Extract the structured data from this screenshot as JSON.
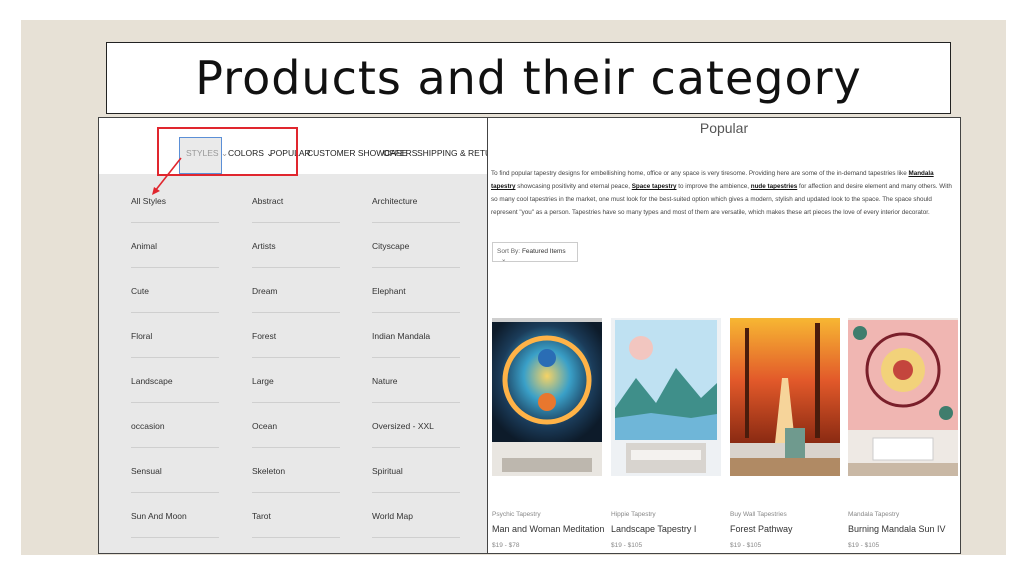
{
  "slide": {
    "title": "Products and their category"
  },
  "nav": {
    "items": [
      {
        "label": "STYLES",
        "chevron": "⌄"
      },
      {
        "label": "COLORS",
        "chevron": "⌄"
      },
      {
        "label": "POPULAR"
      },
      {
        "label": "CUSTOMER SHOWCASE"
      },
      {
        "label": "OFFERS"
      },
      {
        "label": "SHIPPING & RETURNS"
      }
    ]
  },
  "styles_menu": {
    "columns": [
      [
        "All Styles",
        "Animal",
        "Cute",
        "Floral",
        "Landscape",
        "occasion",
        "Sensual",
        "Sun And Moon"
      ],
      [
        "Abstract",
        "Artists",
        "Dream",
        "Forest",
        "Large",
        "Ocean",
        "Skeleton",
        "Tarot"
      ],
      [
        "Architecture",
        "Cityscape",
        "Elephant",
        "Indian Mandala",
        "Nature",
        "Oversized - XXL",
        "Spiritual",
        "World Map"
      ]
    ]
  },
  "popular": {
    "title": "Popular",
    "desc_1": "To find popular tapestry designs for embellishing home, office or any space is very tiresome. Providing here are some of the in-demand tapestries like ",
    "link_1": "Mandala tapestry",
    "desc_2": " showcasing positivity and eternal peace, ",
    "link_2": "Space tapestry",
    "desc_3": " to improve the ambience, ",
    "link_3": "nude tapestries",
    "desc_4": " for affection and desire element and many others. With so many cool tapestries in the market, one must look for the best-suited option which gives a modern, stylish and updated look to the space. The space should represent \"you\" as a person. Tapestries have so many types and most of them are versatile, which makes these art pieces the love of every interior decorator.",
    "sort_label": "Sort By:",
    "sort_value": "Featured Items",
    "sort_chevron": "⌄"
  },
  "products": [
    {
      "category": "Psychic Tapestry",
      "name": "Man and Woman Meditation",
      "price": "$19 - $78"
    },
    {
      "category": "Hippie Tapestry",
      "name": "Landscape Tapestry I",
      "price": "$19 - $105"
    },
    {
      "category": "Buy Wall Tapestries",
      "name": "Forest Pathway",
      "price": "$19 - $105"
    },
    {
      "category": "Mandala Tapestry",
      "name": "Burning Mandala Sun IV",
      "price": "$19 - $105"
    }
  ],
  "colors": {
    "highlight_red": "#e0262e",
    "highlight_blue": "#5b8fd6"
  }
}
